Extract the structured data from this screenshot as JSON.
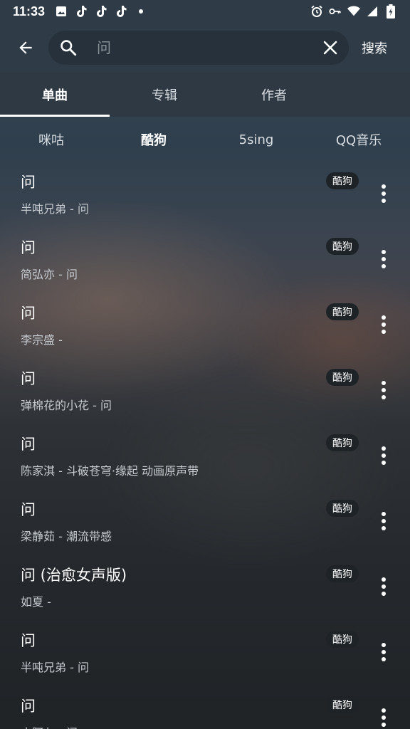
{
  "status": {
    "time": "11:33",
    "left_icons": [
      "image-icon",
      "tiktok-icon",
      "tiktok-icon",
      "tiktok-icon",
      "dot-icon"
    ],
    "right_icons": [
      "alarm-icon",
      "key-icon",
      "wifi-icon",
      "signal-icon",
      "battery-charging-icon"
    ]
  },
  "search": {
    "value": "",
    "placeholder": "问",
    "action_label": "搜索"
  },
  "tabs": [
    {
      "label": "单曲",
      "active": true
    },
    {
      "label": "专辑",
      "active": false
    },
    {
      "label": "作者",
      "active": false
    }
  ],
  "sources": [
    {
      "label": "咪咕",
      "active": false
    },
    {
      "label": "酷狗",
      "active": true
    },
    {
      "label": "5sing",
      "active": false
    },
    {
      "label": "QQ音乐",
      "active": false
    }
  ],
  "songs": [
    {
      "title": "问",
      "subtitle": "半吨兄弟 - 问",
      "source": "酷狗"
    },
    {
      "title": "问",
      "subtitle": "简弘亦 - 问",
      "source": "酷狗"
    },
    {
      "title": "问",
      "subtitle": "李宗盛 -",
      "source": "酷狗"
    },
    {
      "title": "问",
      "subtitle": "弹棉花的小花 - 问",
      "source": "酷狗"
    },
    {
      "title": "问",
      "subtitle": "陈家淇 - 斗破苍穹·缘起 动画原声带",
      "source": "酷狗"
    },
    {
      "title": "问",
      "subtitle": "梁静茹 - 潮流带感",
      "source": "酷狗"
    },
    {
      "title": "问 (治愈女声版)",
      "subtitle": "如夏 -",
      "source": "酷狗"
    },
    {
      "title": "问",
      "subtitle": "半吨兄弟 - 问",
      "source": "酷狗"
    },
    {
      "title": "问",
      "subtitle": "小阿七 - 问",
      "source": "酷狗"
    }
  ]
}
